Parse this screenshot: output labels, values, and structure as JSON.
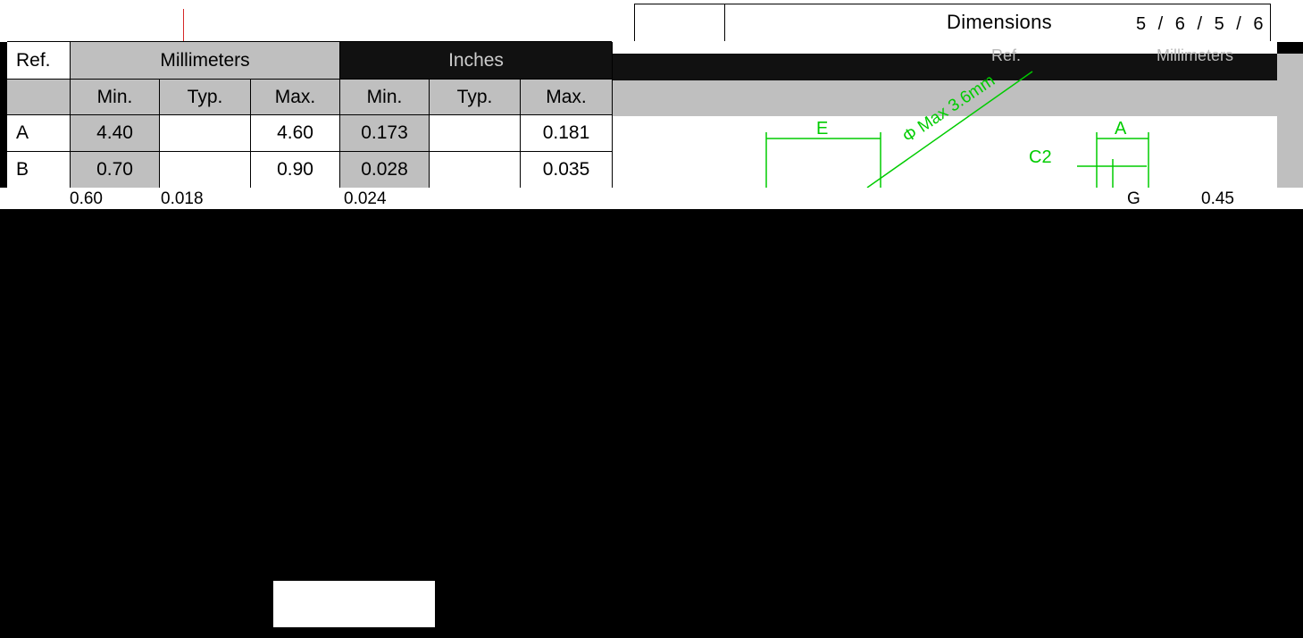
{
  "header": {
    "section_title": "Dimensions",
    "pager": "5 / 6 / 5 / 6"
  },
  "table": {
    "ref_label": "Ref.",
    "group_mm": "Millimeters",
    "group_in": "Inches",
    "columns": [
      "Min.",
      "Typ.",
      "Max.",
      "Min.",
      "Typ.",
      "Max."
    ],
    "rows": [
      {
        "ref": "A",
        "mm_min": "4.40",
        "mm_typ": "",
        "mm_max": "4.60",
        "in_min": "0.173",
        "in_typ": "",
        "in_max": "0.181"
      },
      {
        "ref": "B",
        "mm_min": "0.70",
        "mm_typ": "",
        "mm_max": "0.90",
        "in_min": "0.028",
        "in_typ": "",
        "in_max": "0.035"
      },
      {
        "ref": "",
        "mm_min": "0.60",
        "mm_typ": "",
        "mm_max": "",
        "in_min": "0.018",
        "in_typ": "",
        "in_max": "0.024"
      }
    ]
  },
  "right_table": {
    "ref_label": "Ref.",
    "group_mm": "Millimeters",
    "partial_ref": "G",
    "partial_value": "0.45"
  },
  "drawing": {
    "label_E": "E",
    "label_A": "A",
    "label_C2": "C2",
    "label_phi": "Φ Max 3.6mm",
    "line_color": "#00cc00"
  }
}
